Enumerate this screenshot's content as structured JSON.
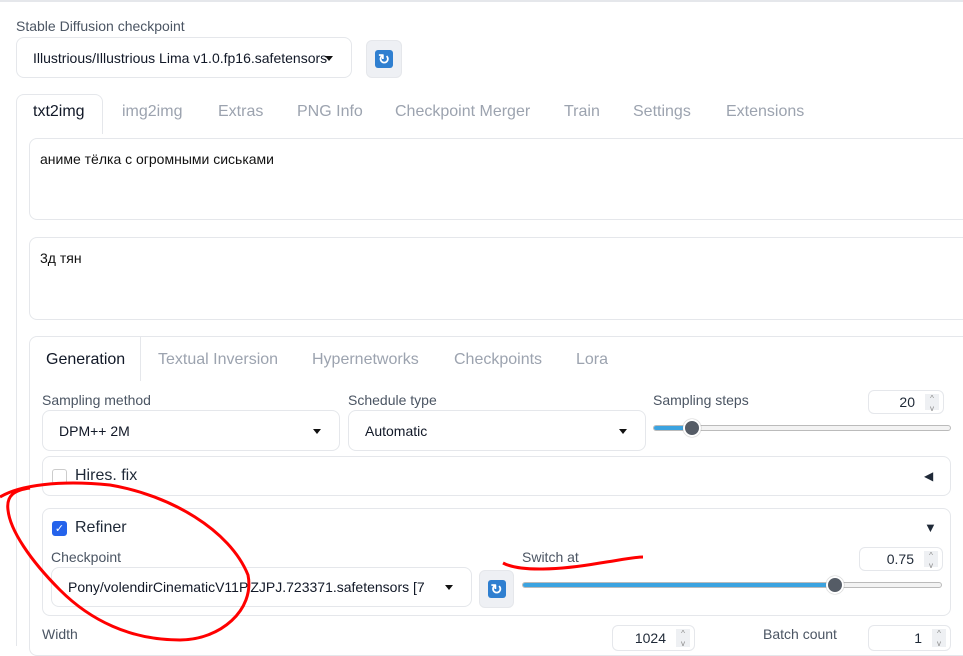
{
  "checkpoint": {
    "label": "Stable Diffusion checkpoint",
    "value": "Illustrious/Illustrious Lima v1.0.fp16.safetensors"
  },
  "tabs": [
    "txt2img",
    "img2img",
    "Extras",
    "PNG Info",
    "Checkpoint Merger",
    "Train",
    "Settings",
    "Extensions"
  ],
  "prompt": "аниме тёлка с огромными сиськами",
  "negative_prompt": "3д тян",
  "subtabs": [
    "Generation",
    "Textual Inversion",
    "Hypernetworks",
    "Checkpoints",
    "Lora"
  ],
  "sampling_method": {
    "label": "Sampling method",
    "value": "DPM++ 2M"
  },
  "schedule_type": {
    "label": "Schedule type",
    "value": "Automatic"
  },
  "sampling_steps": {
    "label": "Sampling steps",
    "value": "20",
    "min": 1,
    "max": 150
  },
  "hires": {
    "label": "Hires. fix",
    "checked": false
  },
  "refiner": {
    "label": "Refiner",
    "checked": true,
    "checkpoint_label": "Checkpoint",
    "checkpoint_value": "Pony/volendirCinematicV11P.ZJPJ.723371.safetensors [7",
    "switch_label": "Switch at",
    "switch_value": "0.75",
    "switch_min": 0.01,
    "switch_max": 1
  },
  "width": {
    "label": "Width",
    "value": "1024"
  },
  "batch_count": {
    "label": "Batch count",
    "value": "1"
  },
  "colors": {
    "accent": "#3ba3e0",
    "checkbox": "#2563eb",
    "annotation": "#ff0000"
  }
}
